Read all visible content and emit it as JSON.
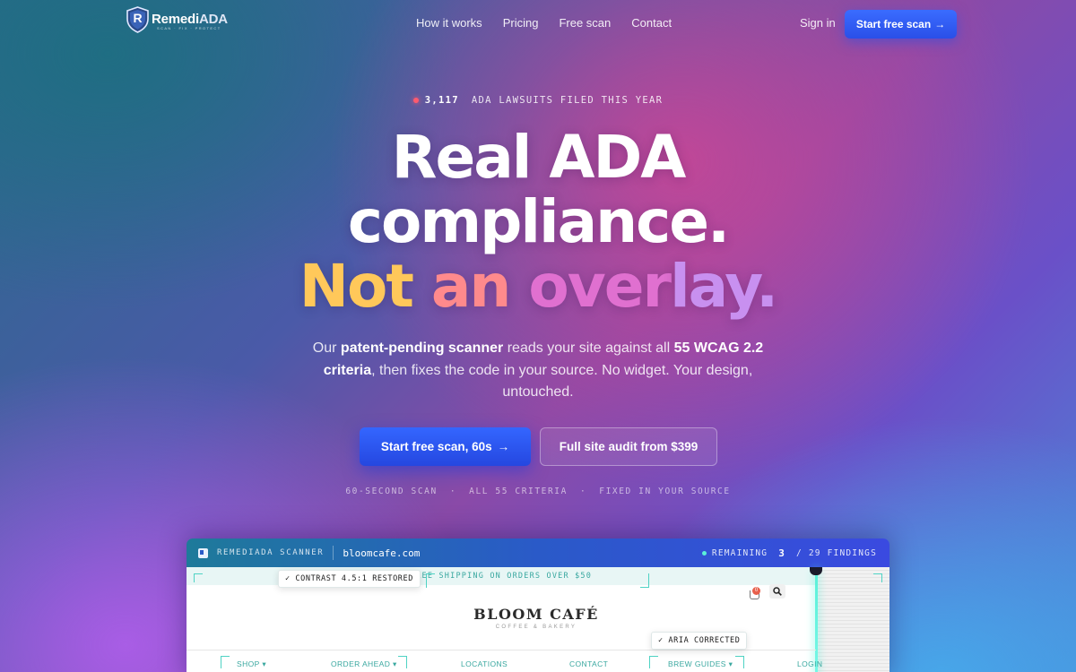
{
  "brand": {
    "name_part1": "Remedi",
    "name_part2": "ADA",
    "tagline": "SCAN · FIX · PROTECT",
    "logo_letter": "R"
  },
  "nav": {
    "links": [
      "How it works",
      "Pricing",
      "Free scan",
      "Contact"
    ],
    "signin": "Sign in",
    "cta": "Start free scan",
    "cta_arrow": "→"
  },
  "hero": {
    "eyebrow_count": "3,117",
    "eyebrow_text": "ADA LAWSUITS FILED THIS YEAR",
    "headline_line1": "Real ADA",
    "headline_line2": "compliance.",
    "headline_line3_parts": [
      "Not",
      " an",
      " over",
      "lay."
    ],
    "sub_1": "Our ",
    "sub_bold_1": "patent-pending scanner",
    "sub_2": " reads your site against all ",
    "sub_bold_2": "55 WCAG 2.2 criteria",
    "sub_3": ", then fixes the code in your source. No widget. Your design, untouched.",
    "cta_primary": "Start free scan, 60s",
    "cta_primary_arrow": "→",
    "cta_secondary": "Full site audit from $399",
    "meta": [
      "60-SECOND SCAN",
      "·",
      "ALL 55 CRITERIA",
      "·",
      "FIXED IN YOUR SOURCE"
    ]
  },
  "scanner": {
    "title": "REMEDIADA SCANNER",
    "domain": "bloomcafe.com",
    "remaining_label": "REMAINING",
    "remaining_count": "3",
    "findings": "/ 29 FINDINGS",
    "site": {
      "banner": "FREE SHIPPING ON ORDERS OVER $50",
      "name": "BLOOM CAFÉ",
      "tagline": "COFFEE & BAKERY",
      "cart_count": "0",
      "nav": [
        "SHOP",
        "ORDER AHEAD",
        "LOCATIONS",
        "CONTACT",
        "BREW GUIDES",
        "LOGIN"
      ],
      "dropdown_marks": [
        "▾",
        "▾",
        "▾"
      ]
    },
    "fix_tags": [
      "✓ CONTRAST 4.5:1 RESTORED",
      "✓ ARIA CORRECTED"
    ]
  },
  "colors": {
    "accent_blue": "#3466ff",
    "scan_teal": "#4fd3c4",
    "gradient_yellow": "#ffc85a",
    "gradient_pink": "#e070d0",
    "gradient_purple": "#c890f0",
    "alert_red": "#ff5a6e"
  },
  "icons": [
    "shield-logo-icon",
    "scanner-icon",
    "cart-icon",
    "search-icon",
    "arrow-right-icon",
    "live-dot-icon"
  ]
}
